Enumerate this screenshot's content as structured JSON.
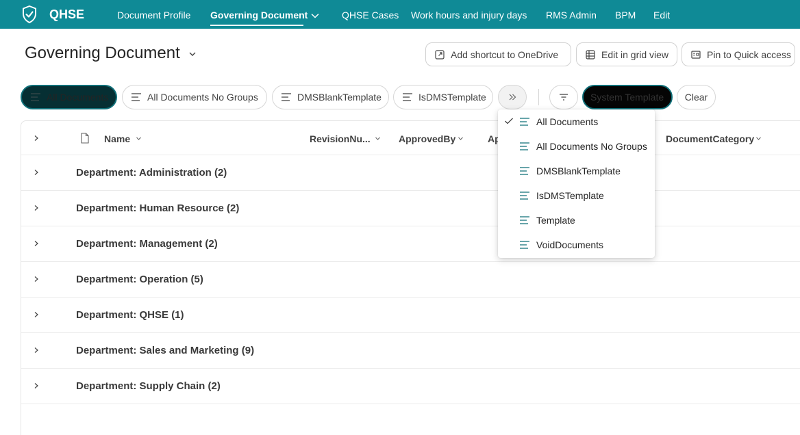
{
  "topnav": {
    "site_title": "QHSE",
    "items": [
      "Document Profile",
      "Governing Document",
      "QHSE Cases",
      "Work hours and injury days",
      "RMS Admin",
      "BPM",
      "Edit"
    ],
    "active_index": 1
  },
  "header": {
    "title": "Governing Document",
    "actions": {
      "add_shortcut": "Add shortcut to OneDrive",
      "edit_grid": "Edit in grid view",
      "pin": "Pin to Quick access"
    }
  },
  "views": {
    "pills": [
      "All Documents",
      "All Documents No Groups",
      "DMSBlankTemplate",
      "IsDMSTemplate"
    ],
    "filter_chip": "System Template",
    "clear_label": "Clear"
  },
  "columns": [
    "Name",
    "RevisionNu...",
    "ApprovedBy",
    "Ap",
    "DocumentCategory"
  ],
  "groups": [
    "Department: Administration (2)",
    "Department: Human Resource (2)",
    "Department: Management (2)",
    "Department: Operation (5)",
    "Department: QHSE (1)",
    "Department: Sales and Marketing (9)",
    "Department: Supply Chain (2)"
  ],
  "view_menu": {
    "items": [
      "All Documents",
      "All Documents No Groups",
      "DMSBlankTemplate",
      "IsDMSTemplate",
      "Template",
      "VoidDocuments"
    ],
    "selected_index": 0
  },
  "colors": {
    "brand": "#0f8a96",
    "active_pill": "#062f33",
    "accent_icon": "#0f6f78"
  }
}
